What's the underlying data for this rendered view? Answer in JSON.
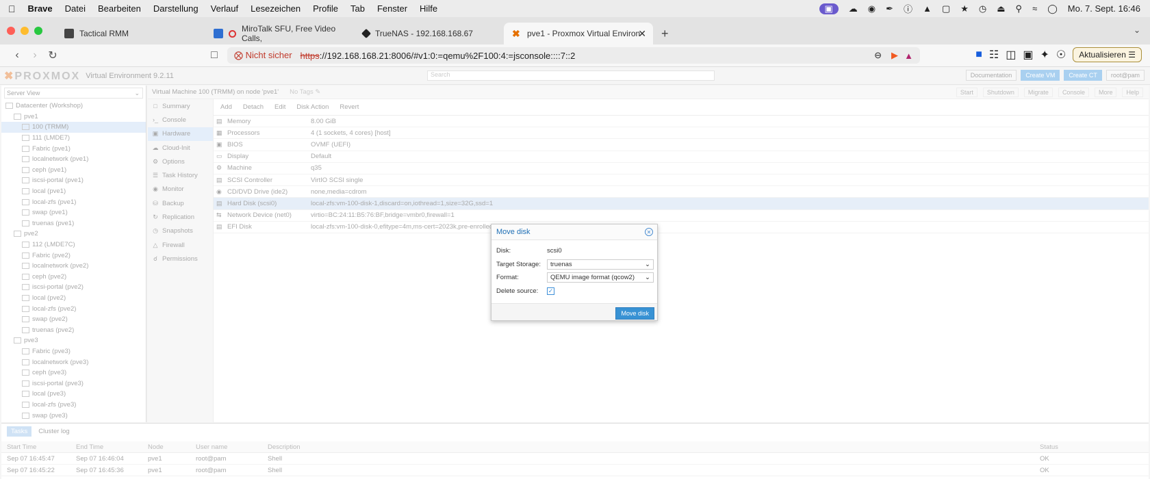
{
  "menubar": {
    "app": "Brave",
    "items": [
      "Datei",
      "Bearbeiten",
      "Darstellung",
      "Verlauf",
      "Lesezeichen",
      "Profile",
      "Tab",
      "Fenster",
      "Hilfe"
    ],
    "datetime": "Mo. 7. Sept.  16:46"
  },
  "tabs": [
    {
      "title": "Tactical RMM"
    },
    {
      "title": "MiroTalk SFU, Free Video Calls,"
    },
    {
      "title": "TrueNAS - 192.168.168.67"
    },
    {
      "title": "pve1 - Proxmox Virtual Environ"
    }
  ],
  "address": {
    "insecure": "Nicht sicher",
    "protocol": "https",
    "rest": "://192.168.168.21:8006/#v1:0:=qemu%2F100:4:=jsconsole::::7::2",
    "update": "Aktualisieren"
  },
  "pve": {
    "logo": "PROXMOX",
    "version": "Virtual Environment 9.2.11",
    "search_placeholder": "Search",
    "header_buttons": [
      "Documentation",
      "Create VM",
      "Create CT",
      "root@pam"
    ],
    "server_view": "Server View",
    "tree": [
      {
        "label": "Datacenter (Workshop)",
        "indent": 0
      },
      {
        "label": "pve1",
        "indent": 1
      },
      {
        "label": "100 (TRMM)",
        "indent": 2,
        "selected": true
      },
      {
        "label": "111 (LMDE7)",
        "indent": 2
      },
      {
        "label": "Fabric (pve1)",
        "indent": 2
      },
      {
        "label": "localnetwork (pve1)",
        "indent": 2
      },
      {
        "label": "ceph (pve1)",
        "indent": 2
      },
      {
        "label": "iscsi-portal (pve1)",
        "indent": 2
      },
      {
        "label": "local (pve1)",
        "indent": 2
      },
      {
        "label": "local-zfs (pve1)",
        "indent": 2
      },
      {
        "label": "swap (pve1)",
        "indent": 2
      },
      {
        "label": "truenas (pve1)",
        "indent": 2
      },
      {
        "label": "pve2",
        "indent": 1
      },
      {
        "label": "112 (LMDE7C)",
        "indent": 2
      },
      {
        "label": "Fabric (pve2)",
        "indent": 2
      },
      {
        "label": "localnetwork (pve2)",
        "indent": 2
      },
      {
        "label": "ceph (pve2)",
        "indent": 2
      },
      {
        "label": "iscsi-portal (pve2)",
        "indent": 2
      },
      {
        "label": "local (pve2)",
        "indent": 2
      },
      {
        "label": "local-zfs (pve2)",
        "indent": 2
      },
      {
        "label": "swap (pve2)",
        "indent": 2
      },
      {
        "label": "truenas (pve2)",
        "indent": 2
      },
      {
        "label": "pve3",
        "indent": 1
      },
      {
        "label": "Fabric (pve3)",
        "indent": 2
      },
      {
        "label": "localnetwork (pve3)",
        "indent": 2
      },
      {
        "label": "ceph (pve3)",
        "indent": 2
      },
      {
        "label": "iscsi-portal (pve3)",
        "indent": 2
      },
      {
        "label": "local (pve3)",
        "indent": 2
      },
      {
        "label": "local-zfs (pve3)",
        "indent": 2
      },
      {
        "label": "swap (pve3)",
        "indent": 2
      }
    ],
    "vm_title": "Virtual Machine 100 (TRMM) on node 'pve1'",
    "tags": "No Tags",
    "vm_buttons": [
      "Start",
      "Shutdown",
      "Migrate",
      "Console",
      "More",
      "Help"
    ],
    "nav": [
      "Summary",
      "Console",
      "Hardware",
      "Cloud-Init",
      "Options",
      "Task History",
      "Monitor",
      "Backup",
      "Replication",
      "Snapshots",
      "Firewall",
      "Permissions"
    ],
    "nav_selected": 2,
    "hw_toolbar": [
      "Add",
      "Detach",
      "Edit",
      "Disk Action",
      "Revert"
    ],
    "hardware": [
      {
        "k": "Memory",
        "v": "8.00 GiB"
      },
      {
        "k": "Processors",
        "v": "4 (1 sockets, 4 cores) [host]"
      },
      {
        "k": "BIOS",
        "v": "OVMF (UEFI)"
      },
      {
        "k": "Display",
        "v": "Default"
      },
      {
        "k": "Machine",
        "v": "q35"
      },
      {
        "k": "SCSI Controller",
        "v": "VirtIO SCSI single"
      },
      {
        "k": "CD/DVD Drive (ide2)",
        "v": "none,media=cdrom"
      },
      {
        "k": "Hard Disk (scsi0)",
        "v": "local-zfs:vm-100-disk-1,discard=on,iothread=1,size=32G,ssd=1",
        "selected": true
      },
      {
        "k": "Network Device (net0)",
        "v": "virtio=BC:24:11:B5:76:BF,bridge=vmbr0,firewall=1"
      },
      {
        "k": "EFI Disk",
        "v": "local-zfs:vm-100-disk-0,efitype=4m,ms-cert=2023k,pre-enrolled-keys=1,size=1M"
      }
    ],
    "bottom_tabs": [
      "Tasks",
      "Cluster log"
    ],
    "task_columns": [
      "Start Time",
      "End Time",
      "Node",
      "User name",
      "Description",
      "Status"
    ],
    "tasks": [
      [
        "Sep 07 16:45:47",
        "Sep 07 16:46:04",
        "pve1",
        "root@pam",
        "Shell",
        "OK"
      ],
      [
        "Sep 07 16:45:22",
        "Sep 07 16:45:36",
        "pve1",
        "root@pam",
        "Shell",
        "OK"
      ]
    ]
  },
  "modal": {
    "title": "Move disk",
    "disk_label": "Disk:",
    "disk_value": "scsi0",
    "target_label": "Target Storage:",
    "target_value": "truenas",
    "format_label": "Format:",
    "format_value": "QEMU image format (qcow2)",
    "delete_label": "Delete source:",
    "button": "Move disk"
  }
}
